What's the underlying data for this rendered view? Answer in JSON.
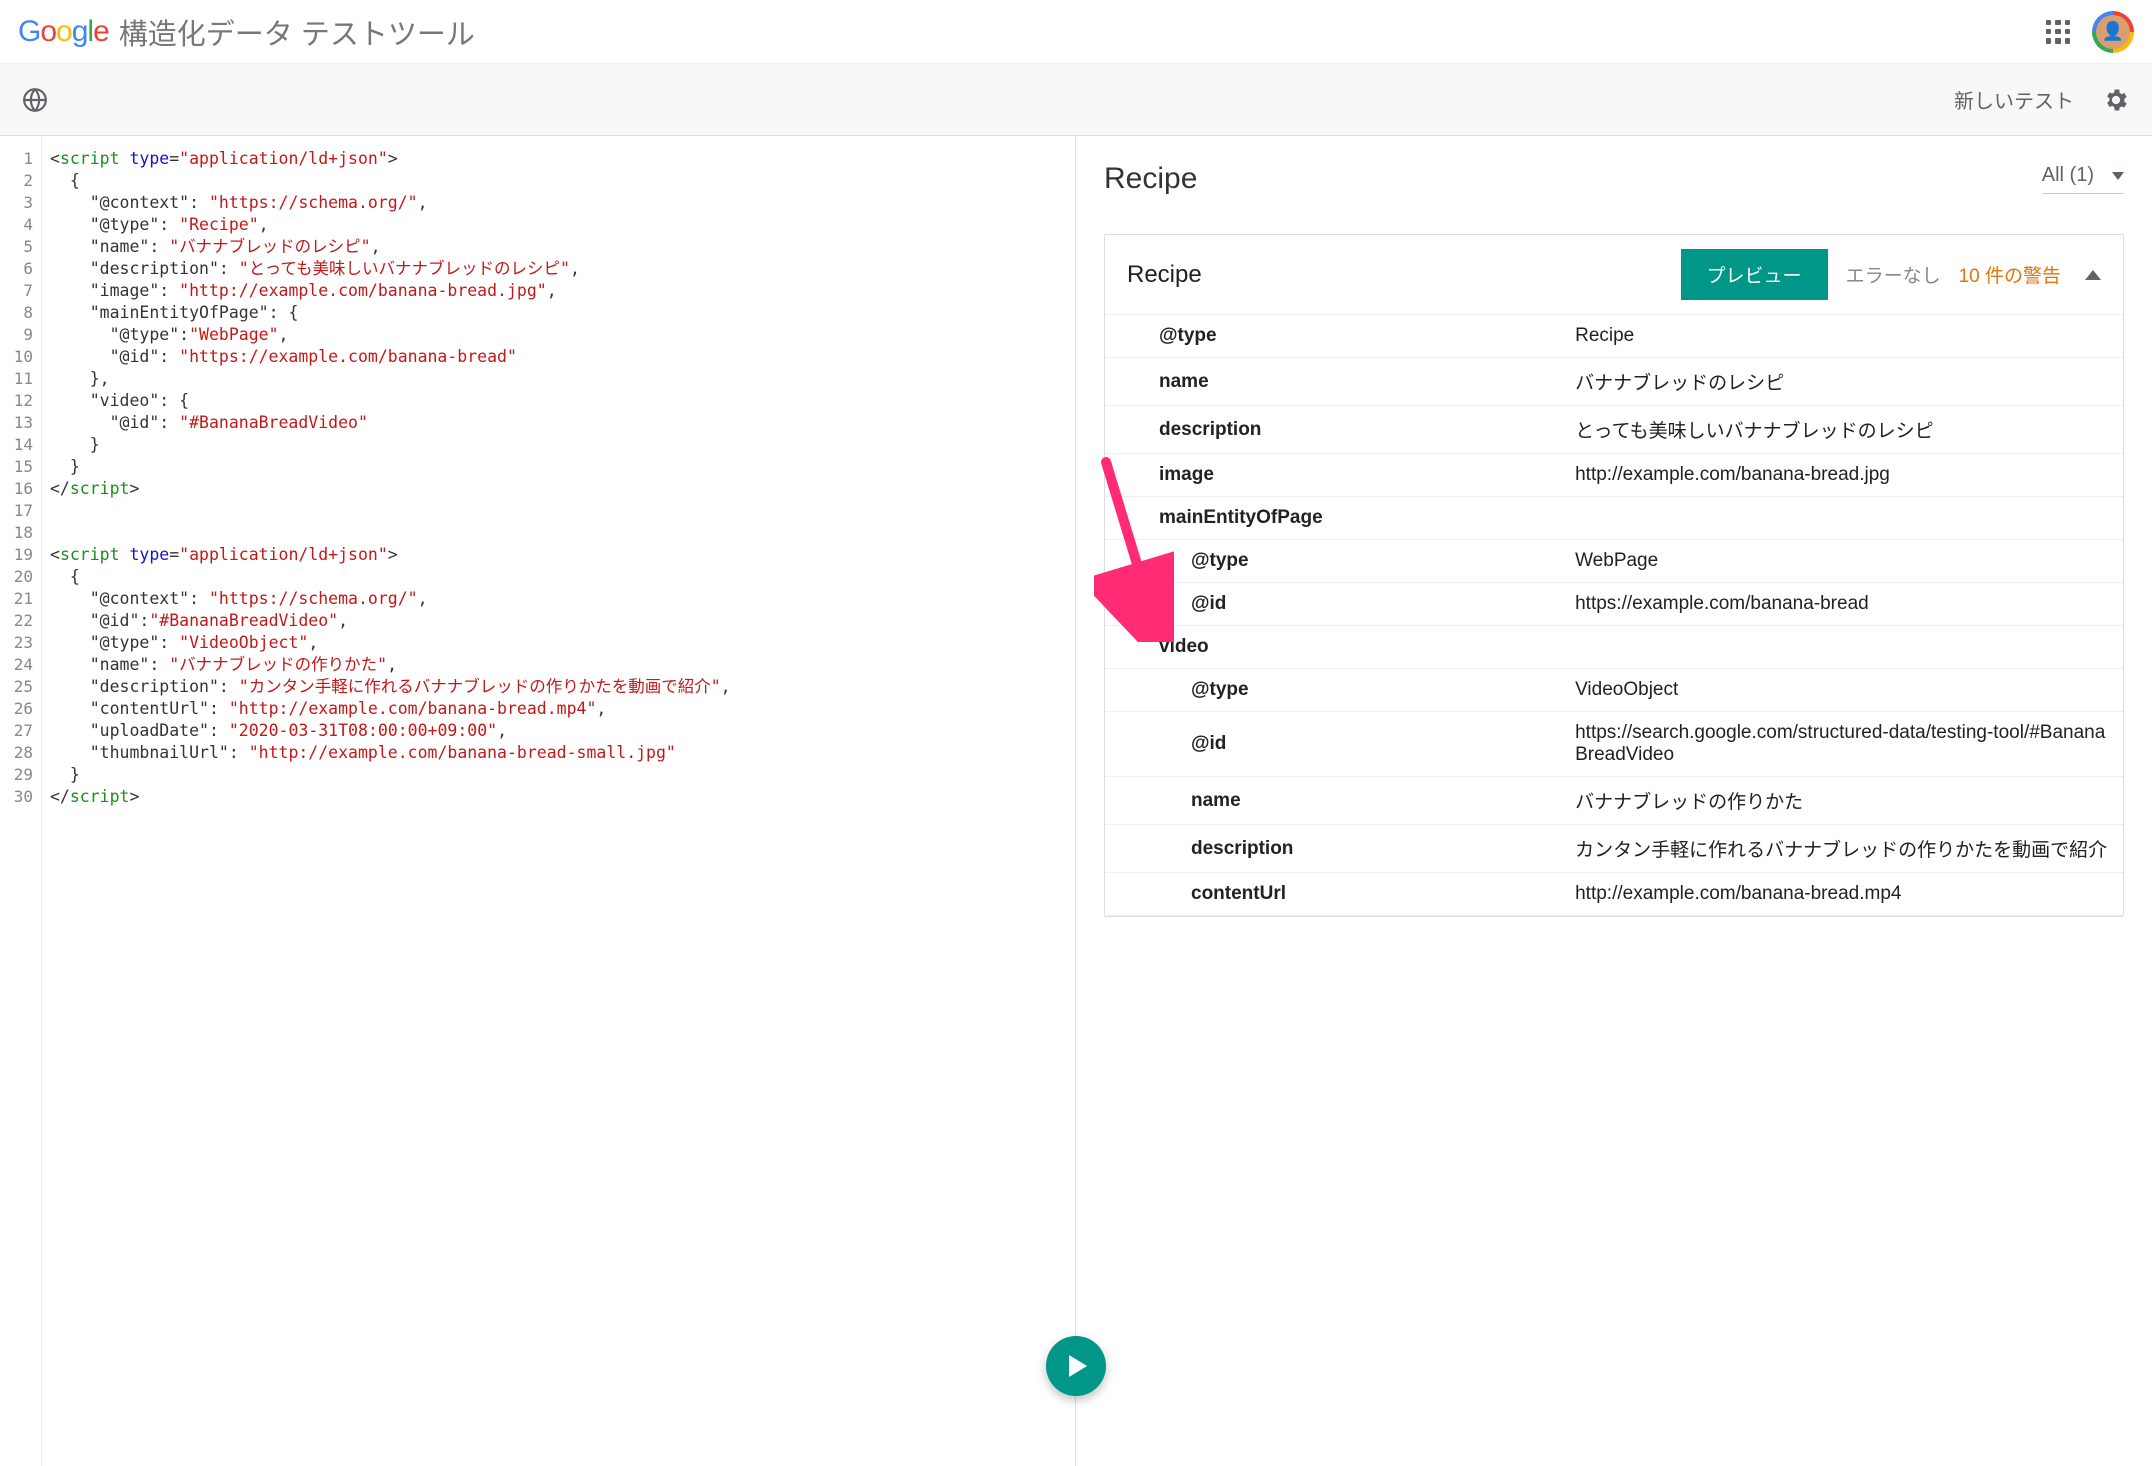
{
  "header": {
    "tool_title": "構造化データ テストツール"
  },
  "subheader": {
    "new_test_label": "新しいテスト"
  },
  "code": {
    "lines": [
      {
        "n": 1,
        "html": "<span class='punc'>&lt;</span><span class='tag'>script</span> <span class='attr'>type</span><span class='punc'>=</span><span class='str'>\"application/ld+json\"</span><span class='punc'>&gt;</span>"
      },
      {
        "n": 2,
        "html": "  <span class='punc'>{</span>"
      },
      {
        "n": 3,
        "html": "    <span class='key'>\"@context\"</span><span class='punc'>:</span> <span class='str'>\"https://schema.org/\"</span><span class='punc'>,</span>"
      },
      {
        "n": 4,
        "html": "    <span class='key'>\"@type\"</span><span class='punc'>:</span> <span class='str'>\"Recipe\"</span><span class='punc'>,</span>"
      },
      {
        "n": 5,
        "html": "    <span class='key'>\"name\"</span><span class='punc'>:</span> <span class='str'>\"バナナブレッドのレシピ\"</span><span class='punc'>,</span>"
      },
      {
        "n": 6,
        "html": "    <span class='key'>\"description\"</span><span class='punc'>:</span> <span class='str'>\"とっても美味しいバナナブレッドのレシピ\"</span><span class='punc'>,</span>"
      },
      {
        "n": 7,
        "html": "    <span class='key'>\"image\"</span><span class='punc'>:</span> <span class='str'>\"http://example.com/banana-bread.jpg\"</span><span class='punc'>,</span>"
      },
      {
        "n": 8,
        "html": "    <span class='key'>\"mainEntityOfPage\"</span><span class='punc'>:</span> <span class='punc'>{</span>"
      },
      {
        "n": 9,
        "html": "      <span class='key'>\"@type\"</span><span class='punc'>:</span><span class='str'>\"WebPage\"</span><span class='punc'>,</span>"
      },
      {
        "n": 10,
        "html": "      <span class='key'>\"@id\"</span><span class='punc'>:</span> <span class='str'>\"https://example.com/banana-bread\"</span>"
      },
      {
        "n": 11,
        "html": "    <span class='punc'>},</span>"
      },
      {
        "n": 12,
        "html": "    <span class='key'>\"video\"</span><span class='punc'>:</span> <span class='punc'>{</span>"
      },
      {
        "n": 13,
        "html": "      <span class='key'>\"@id\"</span><span class='punc'>:</span> <span class='str'>\"#BananaBreadVideo\"</span>"
      },
      {
        "n": 14,
        "html": "    <span class='punc'>}</span>"
      },
      {
        "n": 15,
        "html": "  <span class='punc'>}</span>"
      },
      {
        "n": 16,
        "html": "<span class='punc'>&lt;/</span><span class='tag'>script</span><span class='punc'>&gt;</span>"
      },
      {
        "n": 17,
        "html": " "
      },
      {
        "n": 18,
        "html": " "
      },
      {
        "n": 19,
        "html": "<span class='punc'>&lt;</span><span class='tag'>script</span> <span class='attr'>type</span><span class='punc'>=</span><span class='str'>\"application/ld+json\"</span><span class='punc'>&gt;</span>"
      },
      {
        "n": 20,
        "html": "  <span class='punc'>{</span>"
      },
      {
        "n": 21,
        "html": "    <span class='key'>\"@context\"</span><span class='punc'>:</span> <span class='str'>\"https://schema.org/\"</span><span class='punc'>,</span>"
      },
      {
        "n": 22,
        "html": "    <span class='key'>\"@id\"</span><span class='punc'>:</span><span class='str'>\"#BananaBreadVideo\"</span><span class='punc'>,</span>"
      },
      {
        "n": 23,
        "html": "    <span class='key'>\"@type\"</span><span class='punc'>:</span> <span class='str'>\"VideoObject\"</span><span class='punc'>,</span>"
      },
      {
        "n": 24,
        "html": "    <span class='key'>\"name\"</span><span class='punc'>:</span> <span class='str'>\"バナナブレッドの作りかた\"</span><span class='punc'>,</span>"
      },
      {
        "n": 25,
        "html": "    <span class='key'>\"description\"</span><span class='punc'>:</span> <span class='str'>\"カンタン手軽に作れるバナナブレッドの作りかたを動画で紹介\"</span><span class='punc'>,</span>"
      },
      {
        "n": 26,
        "html": "    <span class='key'>\"contentUrl\"</span><span class='punc'>:</span> <span class='str'>\"http://example.com/banana-bread.mp4\"</span><span class='punc'>,</span>"
      },
      {
        "n": 27,
        "html": "    <span class='key'>\"uploadDate\"</span><span class='punc'>:</span> <span class='str'>\"2020-03-31T08:00:00+09:00\"</span><span class='punc'>,</span>"
      },
      {
        "n": 28,
        "html": "    <span class='key'>\"thumbnailUrl\"</span><span class='punc'>:</span> <span class='str'>\"http://example.com/banana-bread-small.jpg\"</span>"
      },
      {
        "n": 29,
        "html": "  <span class='punc'>}</span>"
      },
      {
        "n": 30,
        "html": "<span class='punc'>&lt;/</span><span class='tag'>script</span><span class='punc'>&gt;</span>"
      }
    ]
  },
  "results": {
    "title": "Recipe",
    "filter_label": "All (1)",
    "card": {
      "title": "Recipe",
      "preview_btn": "プレビュー",
      "error_status": "エラーなし",
      "warn_status": "10 件の警告",
      "rows": [
        {
          "key": "@type",
          "val": "Recipe",
          "cls": "k"
        },
        {
          "key": "name",
          "val": "バナナブレッドのレシピ",
          "cls": "k"
        },
        {
          "key": "description",
          "val": "とっても美味しいバナナブレッドのレシピ",
          "cls": "k"
        },
        {
          "key": "image",
          "val": "http://example.com/banana-bread.jpg",
          "cls": "k"
        },
        {
          "key": "mainEntityOfPage",
          "val": "",
          "cls": "k sect"
        },
        {
          "key": "@type",
          "val": "WebPage",
          "cls": "k sub"
        },
        {
          "key": "@id",
          "val": "https://example.com/banana-bread",
          "cls": "k sub"
        },
        {
          "key": "video",
          "val": "",
          "cls": "k sect"
        },
        {
          "key": "@type",
          "val": "VideoObject",
          "cls": "k sub"
        },
        {
          "key": "@id",
          "val": "https://search.google.com/structured-data/testing-tool/#BananaBreadVideo",
          "cls": "k sub"
        },
        {
          "key": "name",
          "val": "バナナブレッドの作りかた",
          "cls": "k sub"
        },
        {
          "key": "description",
          "val": "カンタン手軽に作れるバナナブレッドの作りかたを動画で紹介",
          "cls": "k sub"
        },
        {
          "key": "contentUrl",
          "val": "http://example.com/banana-bread.mp4",
          "cls": "k sub"
        }
      ]
    }
  }
}
